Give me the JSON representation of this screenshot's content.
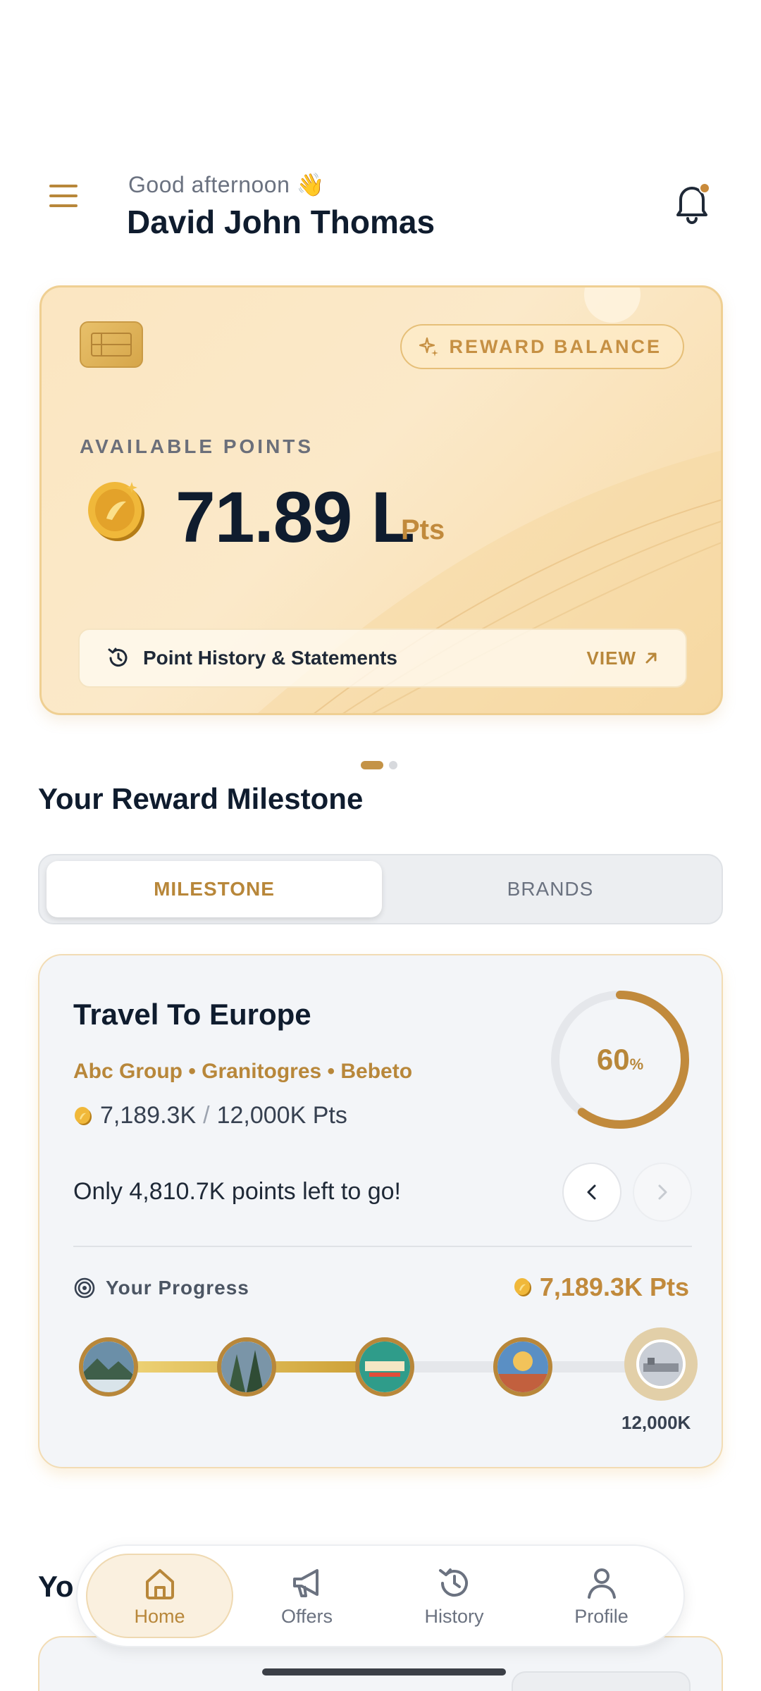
{
  "header": {
    "greeting": "Good afternoon 👋",
    "user_name": "David John Thomas"
  },
  "reward_card": {
    "badge_label": "REWARD BALANCE",
    "available_label": "AVAILABLE POINTS",
    "points_value": "71.89 L",
    "points_unit": "Pts",
    "history_label": "Point History & Statements",
    "view_label": "VIEW"
  },
  "carousel": {
    "total": 2,
    "active": 1
  },
  "section_title": "Your Reward Milestone",
  "toggle": {
    "active": "MILESTONE",
    "inactive": "BRANDS"
  },
  "milestone": {
    "title": "Travel To Europe",
    "brands": "Abc Group • Granitogres • Bebeto",
    "current_pts": "7,189.3K",
    "separator": "/",
    "target_pts": "12,000K Pts",
    "progress_percent": 60,
    "progress_percent_text": "60",
    "percent_symbol": "%",
    "remaining_text": "Only 4,810.7K points left to go!",
    "your_progress_label": "Your Progress",
    "your_progress_value": "7,189.3K Pts",
    "track_fill_fraction": 0.6,
    "final_stop_label": "12,000K"
  },
  "next_section": {
    "title_partial": "Yo"
  },
  "bottom_nav": {
    "items": [
      {
        "label": "Home",
        "icon": "home-icon",
        "active": true
      },
      {
        "label": "Offers",
        "icon": "megaphone-icon",
        "active": false
      },
      {
        "label": "History",
        "icon": "history-icon",
        "active": false
      },
      {
        "label": "Profile",
        "icon": "profile-icon",
        "active": false
      }
    ]
  },
  "colors": {
    "accent": "#b8873a",
    "text_dark": "#0f1c2e",
    "card_bg": "#fbe6c1"
  }
}
